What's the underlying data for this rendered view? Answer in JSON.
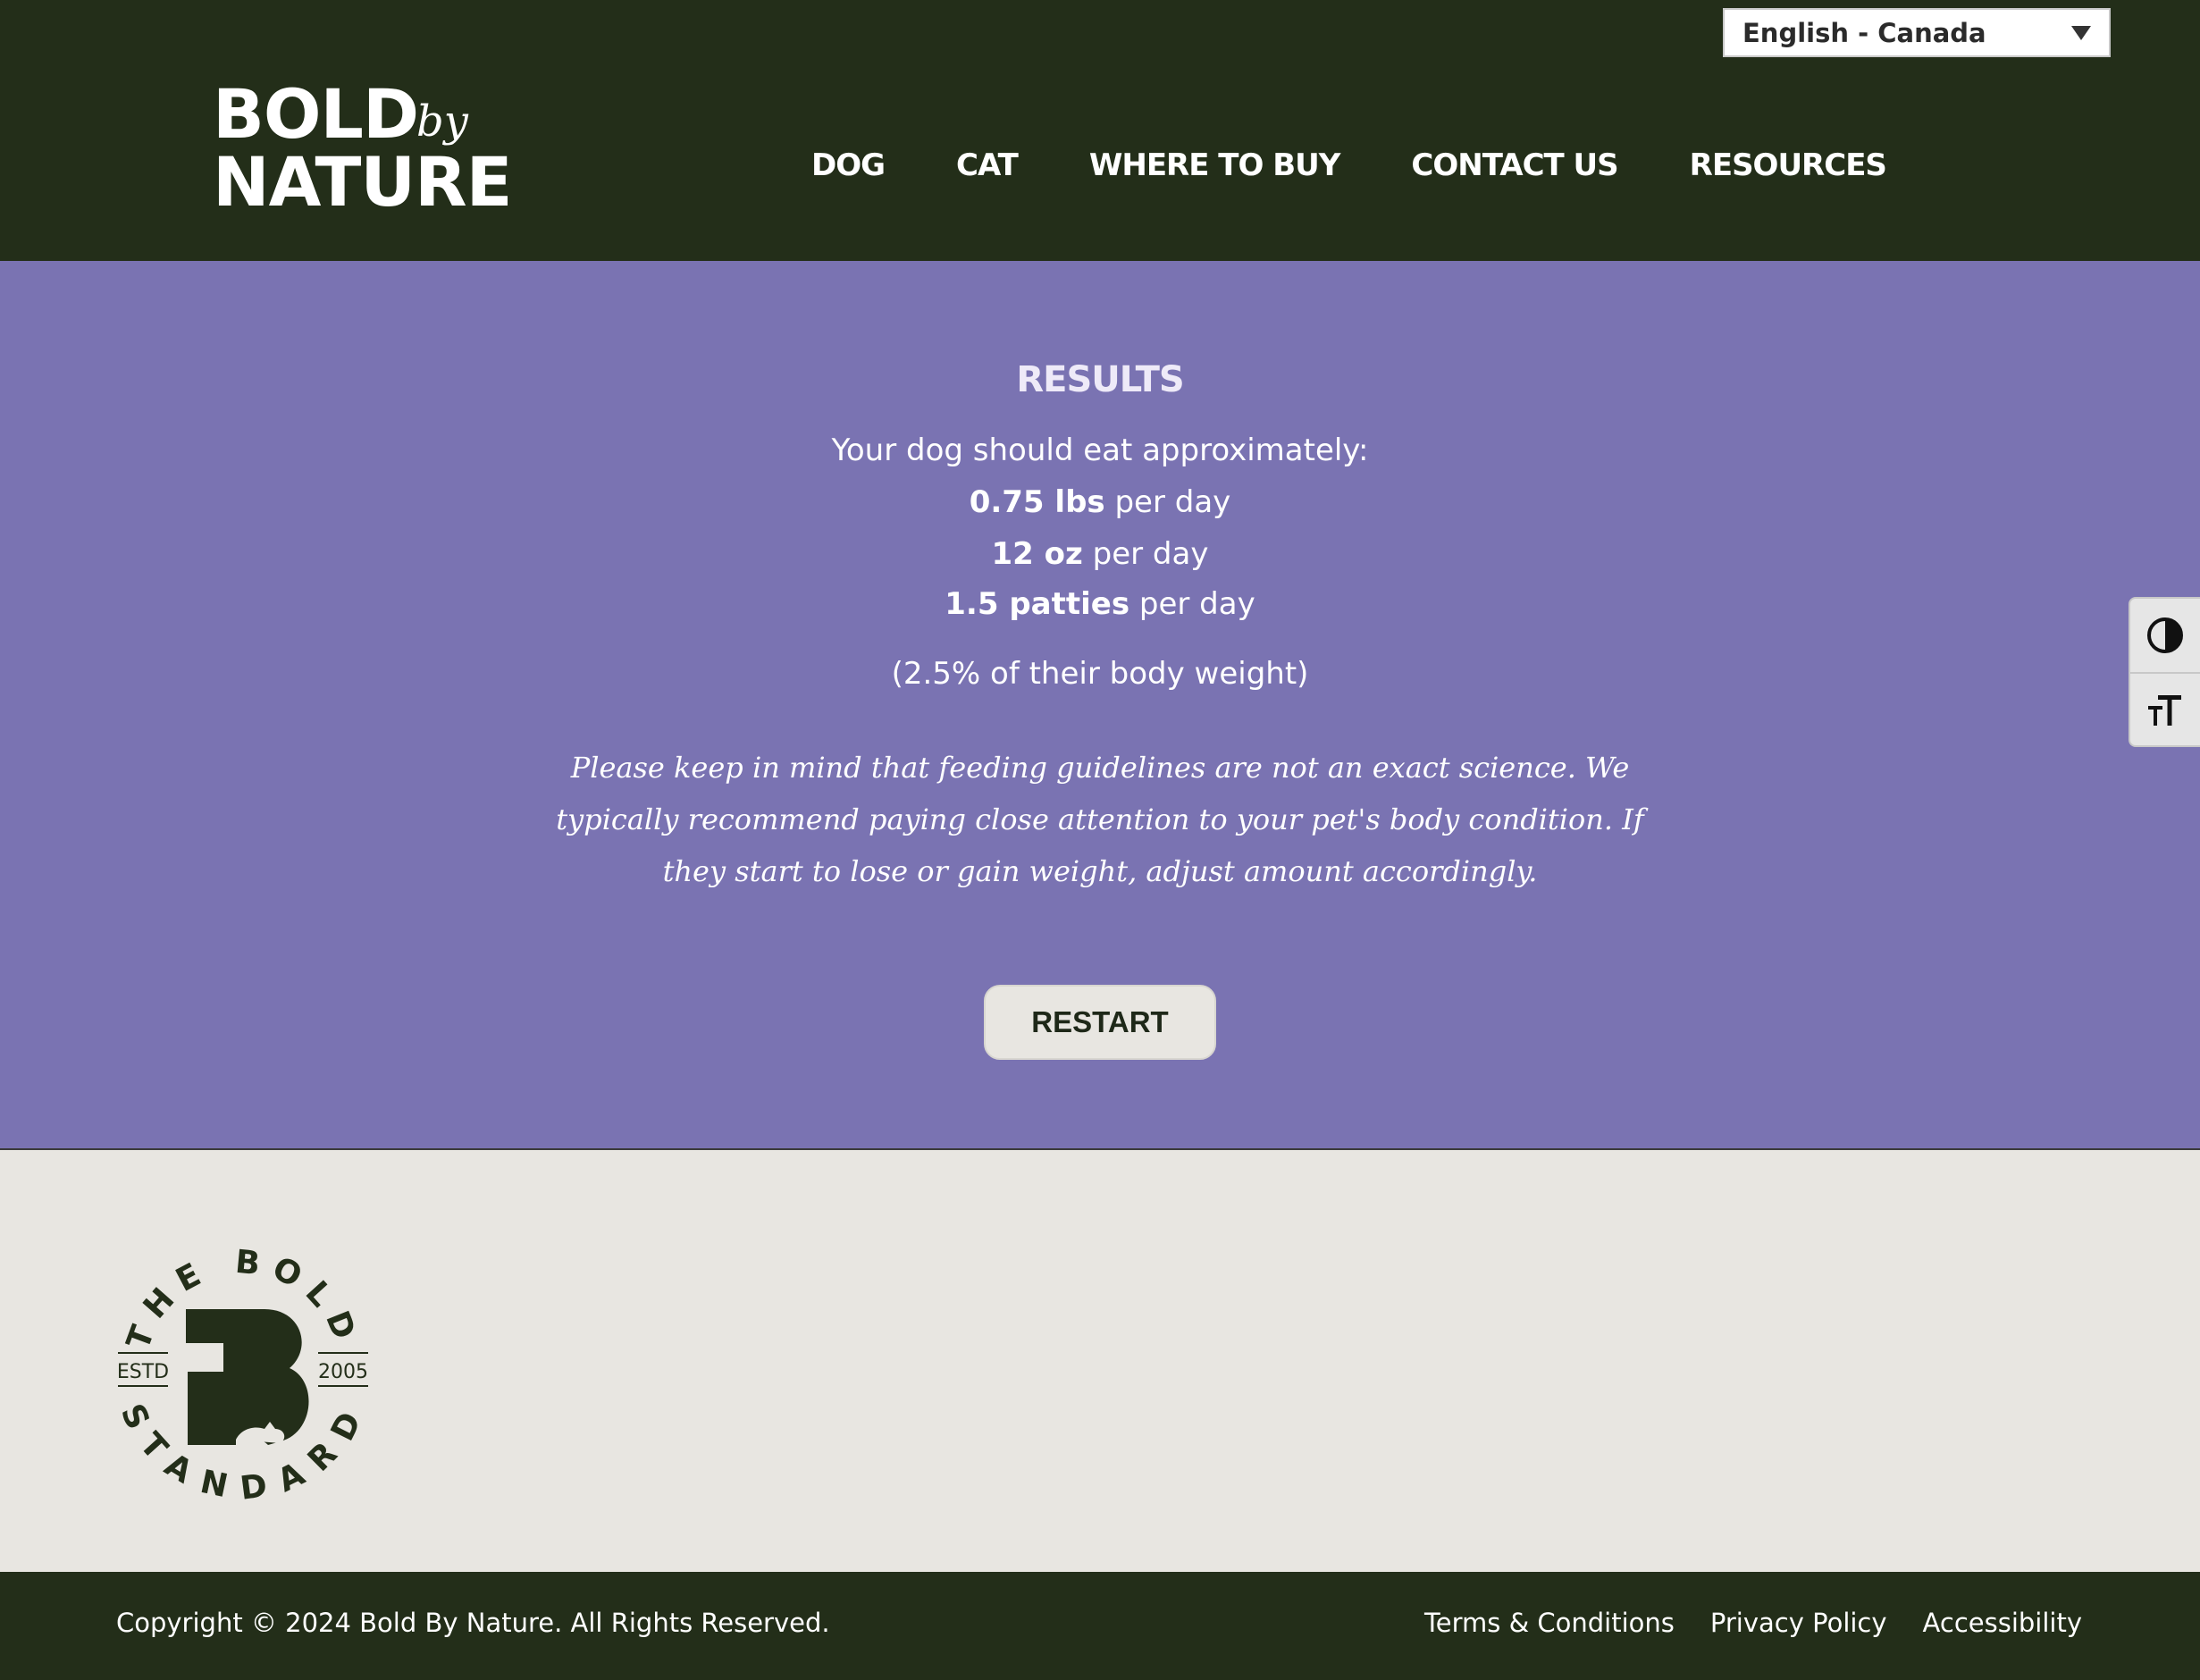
{
  "header": {
    "language": "English - Canada",
    "logo": {
      "line1": "BOLD",
      "by": "by",
      "line2": "NATURE"
    },
    "nav": [
      {
        "label": "DOG"
      },
      {
        "label": "CAT"
      },
      {
        "label": "WHERE TO BUY"
      },
      {
        "label": "CONTACT US"
      },
      {
        "label": "RESOURCES"
      }
    ]
  },
  "results": {
    "title": "RESULTS",
    "intro": "Your dog should eat approximately:",
    "lbs": {
      "value": "0.75 lbs",
      "suffix": " per day"
    },
    "oz": {
      "value": "12 oz",
      "suffix": " per day"
    },
    "patties": {
      "value": "1.5 patties",
      "suffix": " per day"
    },
    "percent": "(2.5% of their body weight)",
    "disclaimer": "Please keep in mind that feeding guidelines are not an exact science. We typically recommend paying close attention to your pet's body condition. If they start to lose or gain weight, adjust amount accordingly.",
    "restart_label": "RESTART"
  },
  "badge": {
    "top": "THE BOLD",
    "bottom": "STANDARD",
    "left": "ESTD",
    "right": "2005",
    "color": "#232e19"
  },
  "footer": {
    "copyright": "Copyright © 2024 Bold By Nature. All Rights Reserved.",
    "links": [
      {
        "label": "Terms & Conditions"
      },
      {
        "label": "Privacy Policy"
      },
      {
        "label": "Accessibility"
      }
    ]
  },
  "colors": {
    "header_bg": "#232e19",
    "results_bg": "#7a73b2",
    "page_bg": "#e8e6e1"
  },
  "icons": {
    "contrast": "contrast-icon",
    "font_size": "font-size-icon"
  }
}
